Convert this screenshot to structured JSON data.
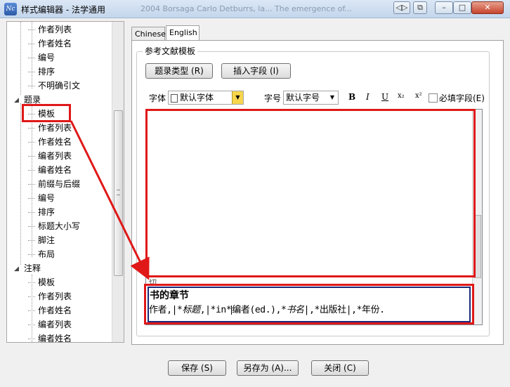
{
  "window": {
    "title": "样式编辑器 - 法学通用",
    "ghost_text": "2004    Borsaga Carlo Detburrs, la...    The emergence of..."
  },
  "tree": {
    "items": [
      {
        "label": "作者列表"
      },
      {
        "label": "作者姓名"
      },
      {
        "label": "编号"
      },
      {
        "label": "排序"
      },
      {
        "label": "不明确引文"
      },
      {
        "label": "题录",
        "group": true
      },
      {
        "label": "模板",
        "selected": true
      },
      {
        "label": "作者列表"
      },
      {
        "label": "作者姓名"
      },
      {
        "label": "编者列表"
      },
      {
        "label": "编者姓名"
      },
      {
        "label": "前缀与后缀"
      },
      {
        "label": "编号"
      },
      {
        "label": "排序"
      },
      {
        "label": "标题大小写"
      },
      {
        "label": "脚注"
      },
      {
        "label": "布局"
      },
      {
        "label": "注释",
        "group": true
      },
      {
        "label": "模板"
      },
      {
        "label": "作者列表"
      },
      {
        "label": "作者姓名"
      },
      {
        "label": "编者列表"
      },
      {
        "label": "编者姓名"
      }
    ]
  },
  "tabs": [
    {
      "label": "Chinese"
    },
    {
      "label": "English",
      "active": true
    }
  ],
  "group_title": "参考文献模板",
  "buttons": {
    "ref_type": "题录类型 (R)",
    "insert_field": "插入字段 (I)",
    "save": "保存 (S)",
    "save_as": "另存为 (A)...",
    "close": "关闭 (C)"
  },
  "format": {
    "font_label": "字体",
    "font_value": "默认字体",
    "size_label": "字号",
    "size_value": "默认字号",
    "bold": "B",
    "italic": "I",
    "underline": "U",
    "subscript": "x₂",
    "superscript": "x²",
    "required_label": "必填字段(E)"
  },
  "editor": {
    "partial_text": "切.",
    "preview_title": "书的章节",
    "preview_parts": [
      "作者,|*",
      "标题",
      ",|*in*",
      "编者(ed.),*",
      "书名",
      "|,*出版社|,*年份."
    ]
  },
  "colors": {
    "annotation_red": "#e01818",
    "selection_navy": "#1a2a7a"
  }
}
